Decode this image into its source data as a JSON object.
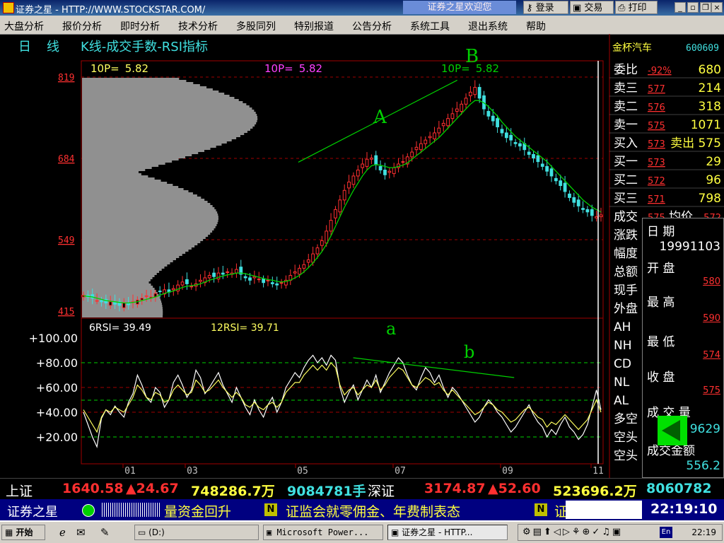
{
  "window": {
    "title": "证券之星 - HTTP://WWW.STOCKSTAR.COM/",
    "welcome": "证券之星欢迎您",
    "buttons": [
      "登录",
      "交易",
      "打印"
    ]
  },
  "menu": [
    "大盘分析",
    "报价分析",
    "即时分析",
    "技术分析",
    "多股同列",
    "特别报道",
    "公告分析",
    "系统工具",
    "退出系统",
    "帮助"
  ],
  "header": {
    "period": "日",
    "mode": "线",
    "title": "K线-成交手数-RSI指标",
    "stock_name": "金杯汽车",
    "stock_code": "600609"
  },
  "colors": {
    "up": "#ff3030",
    "down": "#40e0e0",
    "ma": "#00d000",
    "rsi12": "#ffff60",
    "rsi6": "#ffffff",
    "grid": "#a00000",
    "axis": "#ffffff"
  },
  "chart_data": [
    {
      "type": "candlestick",
      "title": "K线-成交手数-RSI指标",
      "period_label": "10P=",
      "period_value": "5.82",
      "y_ticks": [
        "819",
        "684",
        "549",
        "415"
      ],
      "ylim": [
        405,
        830
      ],
      "x_ticks": [
        "01",
        "03",
        "05",
        "07",
        "09",
        "11"
      ],
      "annotations": [
        "A",
        "B"
      ],
      "trendline": {
        "from": [
          0.34,
          663
        ],
        "to": [
          0.49,
          800
        ]
      },
      "close_series": [
        441,
        438,
        436,
        432,
        430,
        428,
        430,
        426,
        424,
        428,
        425,
        430,
        433,
        436,
        440,
        438,
        444,
        447,
        450,
        446,
        452,
        458,
        463,
        460,
        456,
        460,
        466,
        470,
        474,
        472,
        478,
        476,
        480,
        478,
        484,
        476,
        470,
        466,
        472,
        468,
        462,
        466,
        460,
        458,
        462,
        466,
        474,
        480,
        486,
        492,
        500,
        510,
        520,
        532,
        548,
        566,
        584,
        600,
        616,
        630,
        640,
        650,
        660,
        668,
        670,
        660,
        650,
        642,
        648,
        654,
        660,
        664,
        672,
        680,
        688,
        694,
        700,
        706,
        712,
        720,
        728,
        736,
        744,
        752,
        760,
        770,
        780,
        788,
        770,
        752,
        740,
        732,
        722,
        712,
        704,
        700,
        694,
        690,
        684,
        676,
        670,
        664,
        656,
        648,
        640,
        632,
        624,
        614,
        604,
        596,
        590,
        584,
        580,
        574,
        572,
        575
      ],
      "ma_series": [
        440,
        439,
        438,
        436,
        434,
        432,
        431,
        430,
        429,
        428,
        428,
        429,
        430,
        432,
        434,
        436,
        438,
        441,
        444,
        446,
        448,
        451,
        454,
        456,
        457,
        458,
        460,
        463,
        466,
        468,
        471,
        473,
        475,
        476,
        478,
        478,
        477,
        475,
        473,
        471,
        469,
        467,
        466,
        464,
        463,
        464,
        466,
        470,
        474,
        480,
        487,
        495,
        504,
        514,
        526,
        540,
        556,
        572,
        588,
        602,
        616,
        628,
        640,
        650,
        657,
        659,
        658,
        656,
        654,
        654,
        656,
        658,
        662,
        668,
        674,
        680,
        686,
        692,
        698,
        704,
        712,
        720,
        728,
        736,
        744,
        752,
        760,
        766,
        766,
        762,
        756,
        748,
        740,
        730,
        722,
        714,
        706,
        700,
        694,
        688,
        682,
        676,
        670,
        664,
        656,
        648,
        640,
        632,
        624,
        616,
        608,
        600,
        594,
        588,
        584,
        580
      ],
      "volume_profile_note": "grey horizontal volume-at-price histogram"
    },
    {
      "type": "line",
      "title": "RSI",
      "series": [
        {
          "name": "6RSI",
          "legend": "6RSI= 39.49"
        },
        {
          "name": "12RSI",
          "legend": "12RSI= 39.71"
        }
      ],
      "y_ticks": [
        "+100.00",
        "+80.00",
        "+60.00",
        "+40.00",
        "+20.00"
      ],
      "ylim": [
        0,
        100
      ],
      "annotations": [
        "a",
        "b"
      ],
      "rsi6": [
        40,
        30,
        20,
        12,
        35,
        42,
        38,
        45,
        40,
        36,
        48,
        55,
        70,
        62,
        52,
        48,
        60,
        56,
        44,
        50,
        64,
        70,
        62,
        52,
        58,
        74,
        68,
        55,
        60,
        66,
        72,
        62,
        55,
        48,
        60,
        52,
        44,
        38,
        50,
        42,
        36,
        46,
        52,
        40,
        48,
        60,
        66,
        72,
        68,
        76,
        82,
        86,
        80,
        84,
        78,
        86,
        82,
        60,
        48,
        56,
        62,
        50,
        58,
        66,
        60,
        70,
        56,
        64,
        72,
        78,
        84,
        80,
        70,
        62,
        58,
        68,
        76,
        72,
        64,
        70,
        60,
        52,
        60,
        56,
        50,
        44,
        38,
        32,
        36,
        44,
        50,
        46,
        40,
        36,
        30,
        24,
        28,
        34,
        40,
        46,
        38,
        32,
        28,
        20,
        26,
        22,
        30,
        36,
        28,
        24,
        18,
        22,
        30,
        44,
        58,
        42
      ],
      "rsi12": [
        42,
        36,
        30,
        24,
        36,
        42,
        40,
        44,
        42,
        40,
        46,
        52,
        62,
        58,
        52,
        50,
        56,
        54,
        48,
        50,
        58,
        62,
        58,
        54,
        56,
        66,
        62,
        56,
        58,
        62,
        66,
        60,
        56,
        52,
        56,
        52,
        46,
        44,
        48,
        44,
        42,
        46,
        48,
        44,
        48,
        56,
        60,
        64,
        64,
        70,
        74,
        78,
        74,
        78,
        74,
        80,
        76,
        62,
        54,
        58,
        60,
        54,
        58,
        62,
        60,
        66,
        58,
        62,
        68,
        72,
        76,
        74,
        68,
        62,
        60,
        64,
        68,
        66,
        62,
        64,
        58,
        54,
        58,
        54,
        50,
        46,
        42,
        38,
        40,
        44,
        48,
        46,
        42,
        40,
        36,
        32,
        34,
        38,
        42,
        44,
        40,
        36,
        34,
        28,
        32,
        30,
        34,
        38,
        34,
        30,
        26,
        30,
        34,
        42,
        50,
        40
      ],
      "trendline": {
        "from": [
          0.33,
          84
        ],
        "to": [
          0.6,
          68
        ]
      }
    }
  ],
  "quote_panel": {
    "rows": [
      {
        "label": "委比",
        "price": "-92%",
        "vol": "680"
      },
      {
        "label": "卖三",
        "price": "577",
        "vol": "214"
      },
      {
        "label": "卖二",
        "price": "576",
        "vol": "318"
      },
      {
        "label": "卖一",
        "price": "575",
        "vol": "1071"
      },
      {
        "label": "买入",
        "price": "573",
        "vol": "卖出 575"
      },
      {
        "label": "买一",
        "price": "573",
        "vol": "29"
      },
      {
        "label": "买二",
        "price": "572",
        "vol": "96"
      },
      {
        "label": "买三",
        "price": "571",
        "vol": "798"
      }
    ],
    "extra_labels": [
      "成交",
      "涨跌",
      "幅度",
      "总额",
      "现手",
      "外盘",
      "AH",
      "NH",
      "CD",
      "NL",
      "AL",
      "多空",
      "空头",
      "空头"
    ],
    "avg_label": "均价",
    "avg_value": "572",
    "cdd_value": "575"
  },
  "info_box": {
    "date_label": "日    期",
    "date_value": "19991103",
    "open_label": "开    盘",
    "open_value": "580",
    "high_label": "最    高",
    "high_value": "590",
    "low_label": "最    低",
    "low_value": "574",
    "close_label": "收    盘",
    "close_value": "575",
    "volume_label": "成 交 量",
    "volume_value": "9629",
    "amount_label": "成交金额",
    "amount_value": "556.2"
  },
  "ticker": {
    "sh_label": "上证",
    "sh_index": "1640.58",
    "sh_change": "▲24.67",
    "sh_amount": "748286.7万",
    "sh_volume": "9084781手",
    "sz_label": "深证",
    "sz_index": "3174.87",
    "sz_change": "▲52.60",
    "sz_amount": "523696.2万",
    "sz_volume": "8060782手"
  },
  "news": {
    "brand": "证券之星",
    "text1": "量资金回升",
    "text2": "证监会就零佣金、年费制表态",
    "text3": "证",
    "time": "22:19:10"
  },
  "taskbar": {
    "start": "开始",
    "items": [
      "(D:)",
      "Microsoft Power...",
      "证券之星 - HTTP..."
    ],
    "clock": "22:19"
  }
}
